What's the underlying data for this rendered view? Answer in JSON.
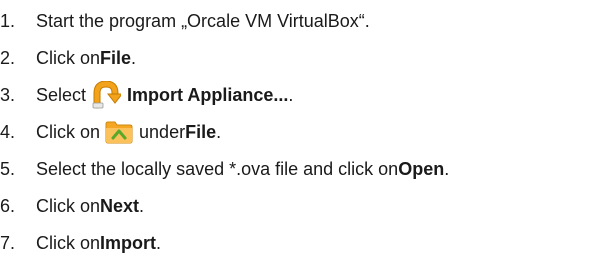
{
  "steps": [
    {
      "number": "1.",
      "text": "Start the program „Orcale VM VirtualBox“."
    },
    {
      "number": "2.",
      "pre": "Click on ",
      "bold": "File",
      "post": "."
    },
    {
      "number": "3.",
      "pre": "Select ",
      "icon": "import-appliance-icon",
      "bold": "Import Appliance...",
      "post": "."
    },
    {
      "number": "4.",
      "pre": "Click on ",
      "icon": "folder-icon",
      "mid": "under ",
      "bold": "File",
      "post": "."
    },
    {
      "number": "5.",
      "pre": "Select the locally saved *.ova file and click on ",
      "bold": "Open",
      "post": "."
    },
    {
      "number": "6.",
      "pre": "Click on ",
      "bold": "Next",
      "post": "."
    },
    {
      "number": "7.",
      "pre": "Click on ",
      "bold": "Import",
      "post": "."
    }
  ],
  "colors": {
    "import_icon_orange": "#f2a31b",
    "folder_icon_orange": "#f5a623",
    "folder_arrow_green": "#5aa82a"
  }
}
